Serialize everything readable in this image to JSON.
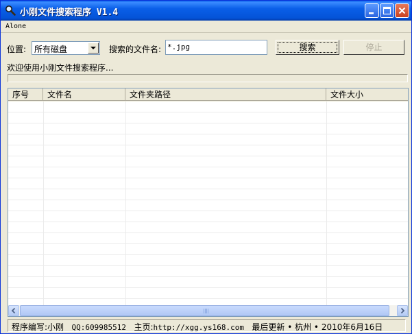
{
  "window": {
    "title": "小刚文件搜索程序 V1.4",
    "title_icon": "magnifier-icon"
  },
  "menu": {
    "items": [
      {
        "label": "Alone"
      }
    ]
  },
  "search": {
    "location_label": "位置:",
    "location_value": "所有磁盘",
    "filename_label": "搜索的文件名:",
    "filename_value": "*.jpg",
    "search_button": "搜索",
    "stop_button": "停止"
  },
  "status_message": "欢迎使用小刚文件搜索程序...",
  "progress": {
    "fraction": 0
  },
  "table": {
    "columns": [
      "序号",
      "文件名",
      "文件夹路径",
      "文件大小"
    ],
    "rows": []
  },
  "statusbar": {
    "author_label": "程序编写:",
    "author": "小刚",
    "qq_label": "QQ:",
    "qq": "609985512",
    "home_label": "主页:",
    "home_url": "http://xgg.ys168.com",
    "updated_label": "最后更新 • 杭州 • ",
    "updated_date": "2010年6月16日"
  },
  "colors": {
    "titlebar": "#0a5fe8",
    "window_bg": "#ece9d8",
    "close_button": "#c8401f"
  }
}
